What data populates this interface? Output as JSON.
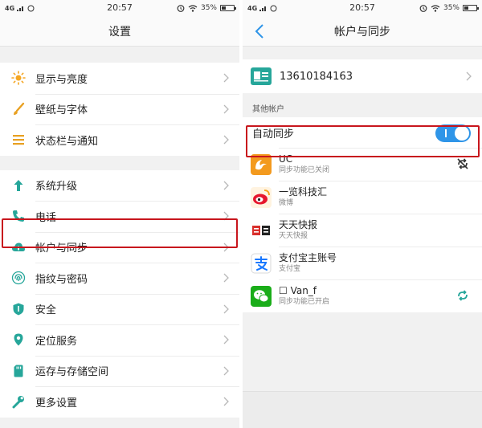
{
  "left": {
    "status": {
      "carrier": "4G",
      "time": "20:57",
      "battery": "35%"
    },
    "title": "设置",
    "groups": [
      {
        "items": [
          {
            "label": "显示与亮度",
            "icon": "brightness-icon"
          },
          {
            "label": "壁纸与字体",
            "icon": "brush-icon"
          },
          {
            "label": "状态栏与通知",
            "icon": "list-icon"
          }
        ]
      },
      {
        "items": [
          {
            "label": "系统升级",
            "icon": "arrow-up-icon"
          },
          {
            "label": "电话",
            "icon": "phone-icon"
          },
          {
            "label": "帐户与同步",
            "icon": "cloud-icon"
          },
          {
            "label": "指纹与密码",
            "icon": "fingerprint-icon"
          },
          {
            "label": "安全",
            "icon": "shield-icon"
          },
          {
            "label": "定位服务",
            "icon": "location-pin-icon"
          },
          {
            "label": "运存与存储空间",
            "icon": "storage-icon"
          },
          {
            "label": "更多设置",
            "icon": "wrench-icon"
          }
        ]
      }
    ]
  },
  "right": {
    "status": {
      "carrier": "4G",
      "time": "20:57",
      "battery": "35%"
    },
    "title": "帐户与同步",
    "account": "13610184163",
    "section_label": "其他帐户",
    "auto_sync": {
      "label": "自动同步",
      "enabled": true
    },
    "apps": [
      {
        "name": "UC",
        "sub": "同步功能已关闭",
        "logo": "uc-logo-icon",
        "action": "sync-off-icon"
      },
      {
        "name": "一览科技汇",
        "sub": "微博",
        "logo": "weibo-logo-icon",
        "action": ""
      },
      {
        "name": "天天快报",
        "sub": "天天快报",
        "logo": "kuaibao-logo-icon",
        "action": ""
      },
      {
        "name": "支付宝主账号",
        "sub": "支付宝",
        "logo": "alipay-logo-icon",
        "action": ""
      },
      {
        "name": "☐ Van_f",
        "sub": "同步功能已开启",
        "logo": "wechat-logo-icon",
        "action": "sync-on-icon"
      }
    ]
  },
  "colors": {
    "accent": "#2f95e8",
    "highlight": "#c8161d",
    "background": "#f1f1f1"
  }
}
